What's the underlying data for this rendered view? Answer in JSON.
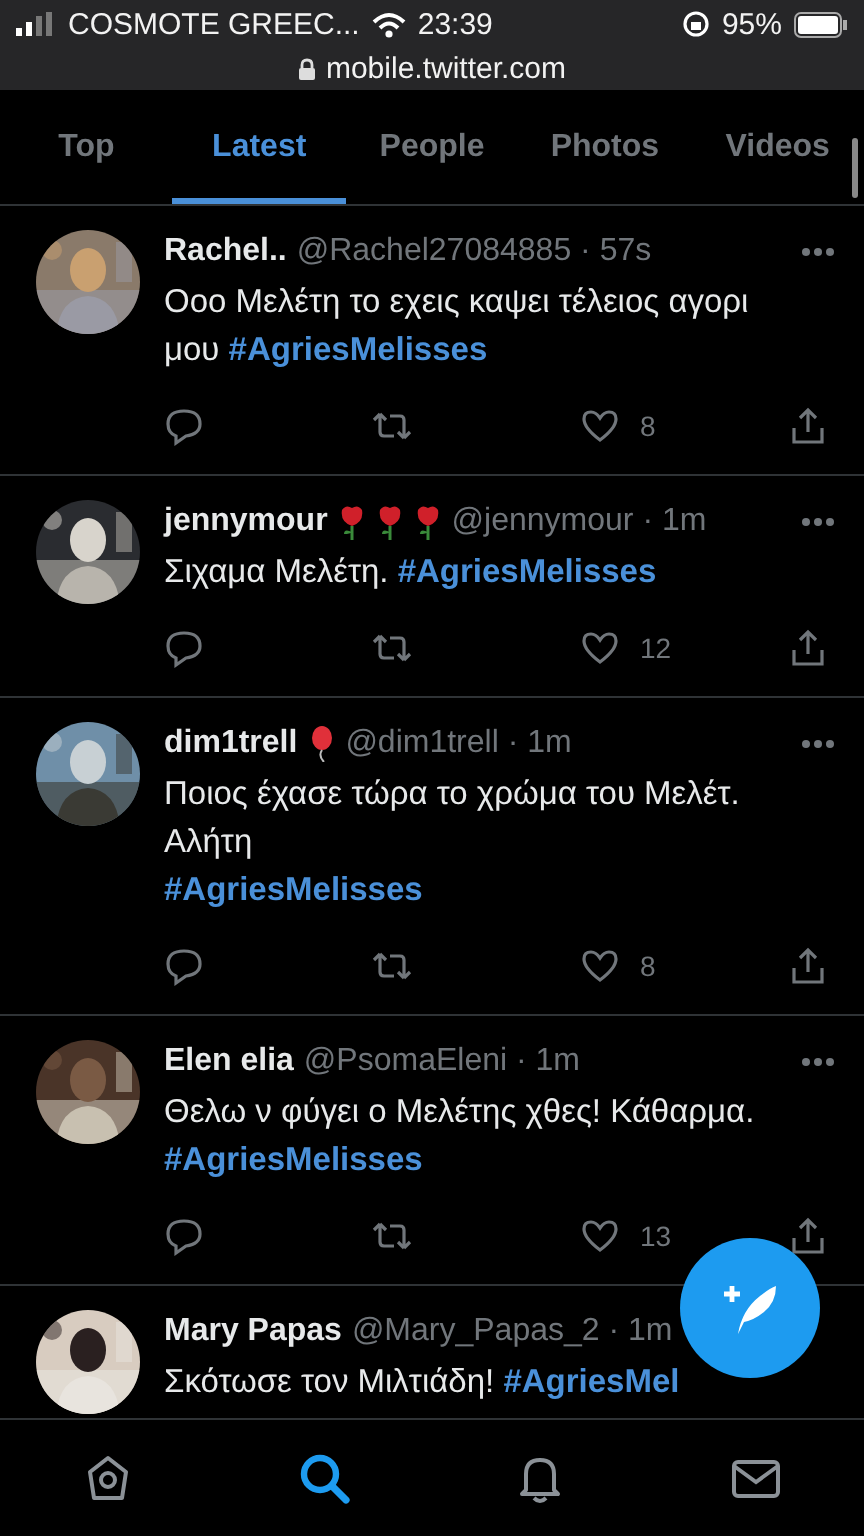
{
  "status_bar": {
    "carrier": "COSMOTE GREEC...",
    "time": "23:39",
    "battery": "95%"
  },
  "address_bar": {
    "url": "mobile.twitter.com"
  },
  "tabs": [
    {
      "label": "Top",
      "selected": false
    },
    {
      "label": "Latest",
      "selected": true
    },
    {
      "label": "People",
      "selected": false
    },
    {
      "label": "Photos",
      "selected": false
    },
    {
      "label": "Videos",
      "selected": false
    }
  ],
  "tweets": [
    {
      "avatar": {
        "kind": "picture"
      },
      "name": "Rachel..",
      "menu_button": true,
      "handle": "@Rachel27084885 · 57s",
      "text": "Οοο Μελέτη το εχεις καψει τέλειος αγορι μου **#AgriesMelisses**",
      "likes": "8"
    },
    {
      "avatar": {
        "kind": "picture"
      },
      "name": "jennymour",
      "name_badges": [
        {
          "kind": "rose"
        },
        {
          "kind": "rose"
        },
        {
          "kind": "rose"
        }
      ],
      "menu_button": true,
      "handle": "@jennymour · 1m",
      "text": "Σιχαμα Μελέτη. **#AgriesMelisses**",
      "likes": "12"
    },
    {
      "avatar": {
        "kind": "picture"
      },
      "name": "dim1trell",
      "name_badges": [
        {
          "kind": "balloon"
        }
      ],
      "menu_button": true,
      "handle": "@dim1trell · 1m",
      "text": "Ποιος έχασε τώρα το χρώμα του Μελέτ. Αλήτη\n**#AgriesMelisses**",
      "likes": "8"
    },
    {
      "avatar": {
        "kind": "picture"
      },
      "name": "Elen elia",
      "menu_button": true,
      "handle": "@PsomaEleni · 1m",
      "text": "Θελω ν φύγει ο Μελέτης χθες! Κάθαρμα. **#AgriesMelisses**",
      "likes": "13"
    },
    {
      "avatar": {
        "kind": "picture"
      },
      "name": "Mary Papas",
      "handle": "@Mary_Papas_2 · 1m",
      "text": "Σκότωσε τον Μιλτιάδη! **#AgriesMel**"
    }
  ],
  "bottom_nav": [
    {
      "kind": "home",
      "selected": false
    },
    {
      "kind": "search",
      "selected": true
    },
    {
      "kind": "notifications",
      "selected": false
    },
    {
      "kind": "messages",
      "selected": false
    }
  ]
}
